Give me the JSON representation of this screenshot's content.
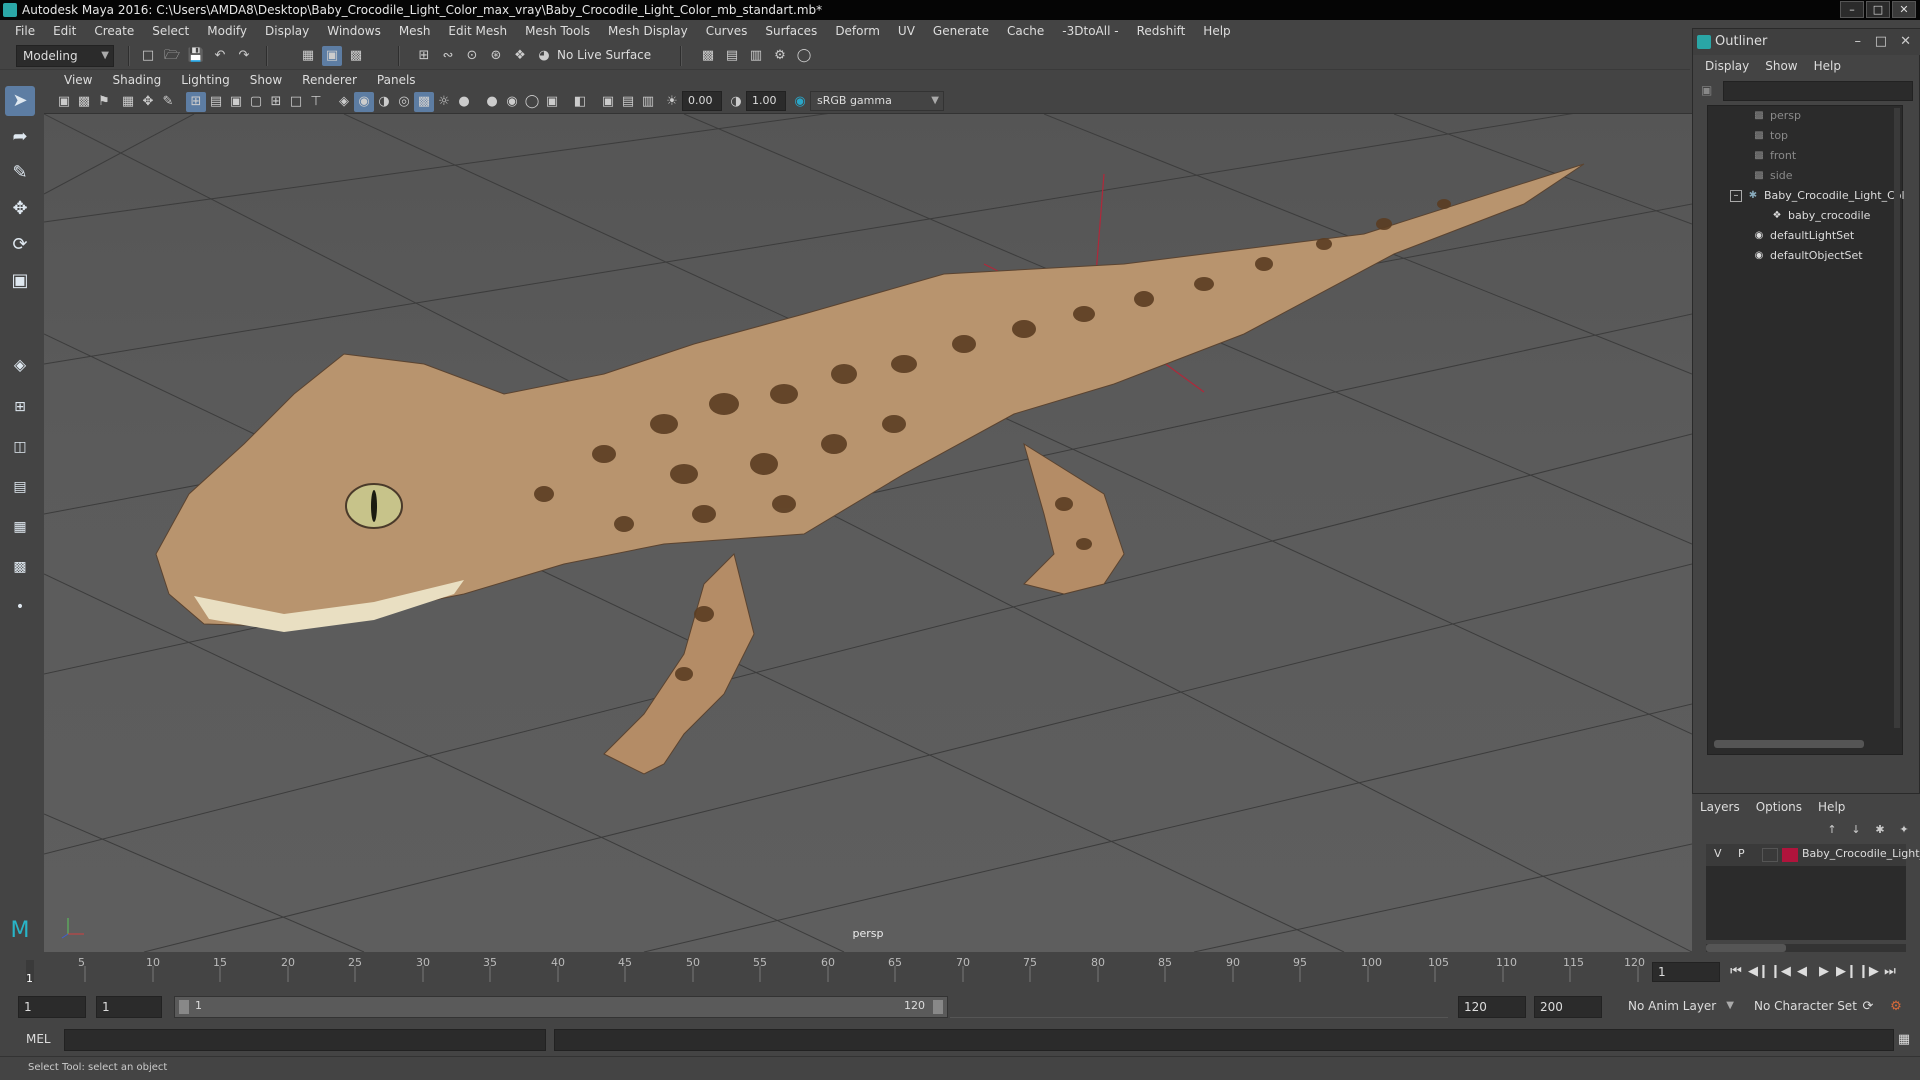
{
  "window": {
    "title": "Autodesk Maya 2016: C:\\Users\\AMDA8\\Desktop\\Baby_Crocodile_Light_Color_max_vray\\Baby_Crocodile_Light_Color_mb_standart.mb*"
  },
  "menubar": [
    "File",
    "Edit",
    "Create",
    "Select",
    "Modify",
    "Display",
    "Windows",
    "Mesh",
    "Edit Mesh",
    "Mesh Tools",
    "Mesh Display",
    "Curves",
    "Surfaces",
    "Deform",
    "UV",
    "Generate",
    "Cache",
    "-3DtoAll -",
    "Redshift",
    "Help"
  ],
  "shelf": {
    "mode": "Modeling",
    "live_surface": "No Live Surface"
  },
  "viewport": {
    "menu": [
      "View",
      "Shading",
      "Lighting",
      "Show",
      "Renderer",
      "Panels"
    ],
    "exposure": "0.00",
    "gamma": "1.00",
    "color_space": "sRGB gamma",
    "camera_label": "persp"
  },
  "outliner": {
    "title": "Outliner",
    "menu": [
      "Display",
      "Show",
      "Help"
    ],
    "items": [
      {
        "label": "persp",
        "icon": "camera-icon"
      },
      {
        "label": "top",
        "icon": "camera-icon"
      },
      {
        "label": "front",
        "icon": "camera-icon"
      },
      {
        "label": "side",
        "icon": "camera-icon"
      },
      {
        "label": "Baby_Crocodile_Light_Col",
        "icon": "group-icon"
      },
      {
        "label": "baby_crocodile",
        "icon": "mesh-icon"
      },
      {
        "label": "defaultLightSet",
        "icon": "set-icon"
      },
      {
        "label": "defaultObjectSet",
        "icon": "set-icon"
      }
    ]
  },
  "layers": {
    "menu": [
      "Layers",
      "Options",
      "Help"
    ],
    "row": {
      "v": "V",
      "p": "P",
      "name": "Baby_Crocodile_Light_",
      "color": "#b0143c"
    }
  },
  "timeline": {
    "ticks": [
      "5",
      "10",
      "15",
      "20",
      "25",
      "30",
      "35",
      "40",
      "45",
      "50",
      "55",
      "60",
      "65",
      "70",
      "75",
      "80",
      "85",
      "90",
      "95",
      "100",
      "105",
      "110",
      "115",
      "120"
    ],
    "current_marker": "1",
    "current_frame": "1"
  },
  "range": {
    "start": "1",
    "anim_start": "1",
    "slider_start": "1",
    "slider_end": "120",
    "anim_end": "120",
    "end": "200",
    "anim_layer": "No Anim Layer",
    "character_set": "No Character Set"
  },
  "command": {
    "lang": "MEL"
  },
  "help": {
    "text": "Select Tool: select an object"
  },
  "colors": {
    "accent": "#5d7da3",
    "ui_bg": "#444444",
    "field_bg": "#2b2b2b",
    "layer_color": "#b0143c"
  }
}
